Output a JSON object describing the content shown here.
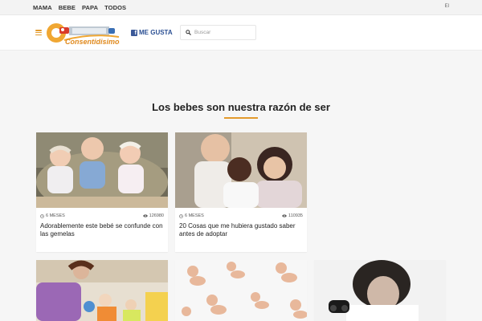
{
  "topnav": {
    "items": [
      "MAMA",
      "BEBE",
      "PAPA",
      "TODOS"
    ],
    "lang": "El"
  },
  "header": {
    "logo_text": "Consentidisimos",
    "fb_label": "ME GUSTA",
    "search_placeholder": "Buscar"
  },
  "section": {
    "title": "Los bebes son nuestra razón de ser"
  },
  "cards": [
    {
      "age": "6 MESES",
      "views": "126980",
      "title": "Adorablemente este bebé se confunde con las gemelas"
    },
    {
      "age": "6 MESES",
      "views": "110935",
      "title": "20 Cosas que me hubiera gustado saber antes de adoptar"
    }
  ],
  "colors": {
    "accent": "#e39a2c",
    "facebook": "#3b5998"
  }
}
